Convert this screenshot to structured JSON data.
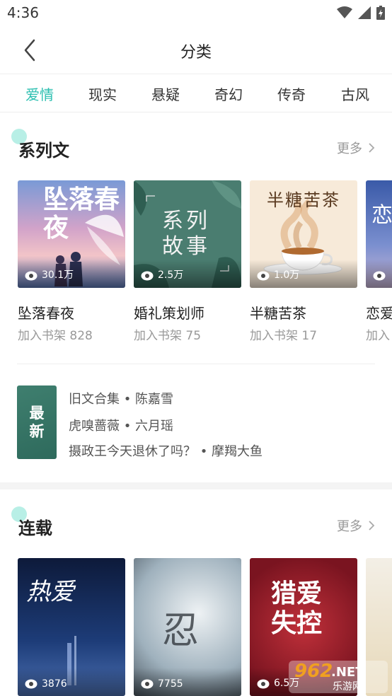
{
  "status_bar": {
    "time": "4:36"
  },
  "header": {
    "title": "分类"
  },
  "tabs": [
    {
      "label": "爱情",
      "active": true
    },
    {
      "label": "现实",
      "active": false
    },
    {
      "label": "悬疑",
      "active": false
    },
    {
      "label": "奇幻",
      "active": false
    },
    {
      "label": "传奇",
      "active": false
    },
    {
      "label": "古风",
      "active": false
    }
  ],
  "series": {
    "title": "系列文",
    "more_label": "更多",
    "books": [
      {
        "title": "坠落春夜",
        "sub": "加入书架 828",
        "views": "30.1万",
        "cover_text": "坠落春夜"
      },
      {
        "title": "婚礼策划师",
        "sub": "加入书架 75",
        "views": "2.5万",
        "cover_text": "系列故事"
      },
      {
        "title": "半糖苦茶",
        "sub": "加入书架 17",
        "views": "1.0万",
        "cover_text": "半糖苦茶"
      },
      {
        "title": "恋爱",
        "sub": "加入",
        "views": "",
        "cover_text": "恋"
      }
    ],
    "latest_label_1": "最",
    "latest_label_2": "新",
    "updates": [
      "旧文合集 • 陈嘉雪",
      "虎嗅蔷薇 • 六月瑶",
      "摄政王今天退休了吗？ • 摩羯大鱼"
    ]
  },
  "serial": {
    "title": "连载",
    "more_label": "更多",
    "books": [
      {
        "views": "3876",
        "cover_text": "热爱"
      },
      {
        "views": "7755",
        "cover_text": "忍"
      },
      {
        "views": "6.5万",
        "cover_text": "猎爱失控"
      }
    ]
  },
  "watermark": {
    "number": "962",
    "suffix": ".NET",
    "sub": "乐游网"
  }
}
